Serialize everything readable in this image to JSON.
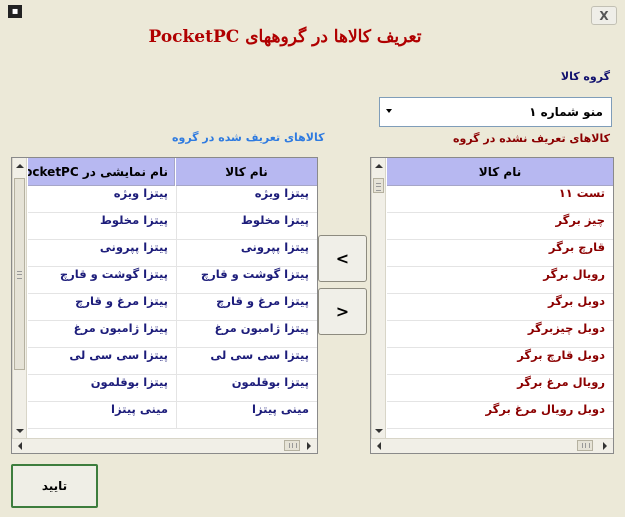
{
  "window": {
    "close_label": "X"
  },
  "title": "تعریف کالاها در گروههای PocketPC",
  "group_label": "گروه کالا",
  "group_select": {
    "value": "منو شماره ۱"
  },
  "undefined_label": "کالاهای تعریف نشده در گروه",
  "defined_label": "کالاهای تعریف شده در گروه",
  "right_grid": {
    "header": "نام کالا",
    "rows": [
      "تست ۱۱",
      "چیز برگر",
      "قارچ برگر",
      "رویال برگر",
      "دوبل برگر",
      "دوبل چیزبرگر",
      "دوبل قارچ برگر",
      "رویال مرغ برگر",
      "دوبل رویال مرغ برگر"
    ]
  },
  "left_grid": {
    "col_name_header": "نام کالا",
    "col_display_header": "نام نمایشی در PocketPC",
    "rows": [
      {
        "name": "پیتزا ویژه",
        "display": "پیتزا ویژه"
      },
      {
        "name": "پیتزا مخلوط",
        "display": "پیتزا مخلوط"
      },
      {
        "name": "پیتزا پپرونی",
        "display": "پیتزا پپرونی"
      },
      {
        "name": "پیتزا گوشت و قارچ",
        "display": "پیتزا گوشت و قارچ"
      },
      {
        "name": "پیتزا مرغ و قارچ",
        "display": "پیتزا مرغ و قارچ"
      },
      {
        "name": "پیتزا ژامبون مرغ",
        "display": "پیتزا ژامبون مرغ"
      },
      {
        "name": "پیتزا سی سی لی",
        "display": "پیتزا سی سی لی"
      },
      {
        "name": "پیتزا بوقلمون",
        "display": "پیتزا بوقلمون"
      },
      {
        "name": "مینی پیتزا",
        "display": "مینی پیتزا"
      }
    ]
  },
  "move_buttons": {
    "add": "<",
    "remove": ">"
  },
  "ok_button": "تایید",
  "colors": {
    "title": "#b00000",
    "header_bg": "#b7b8f1",
    "right_rows": "#8b0000",
    "left_rows": "#1c1c7a",
    "defined_label": "#2f7be0"
  }
}
